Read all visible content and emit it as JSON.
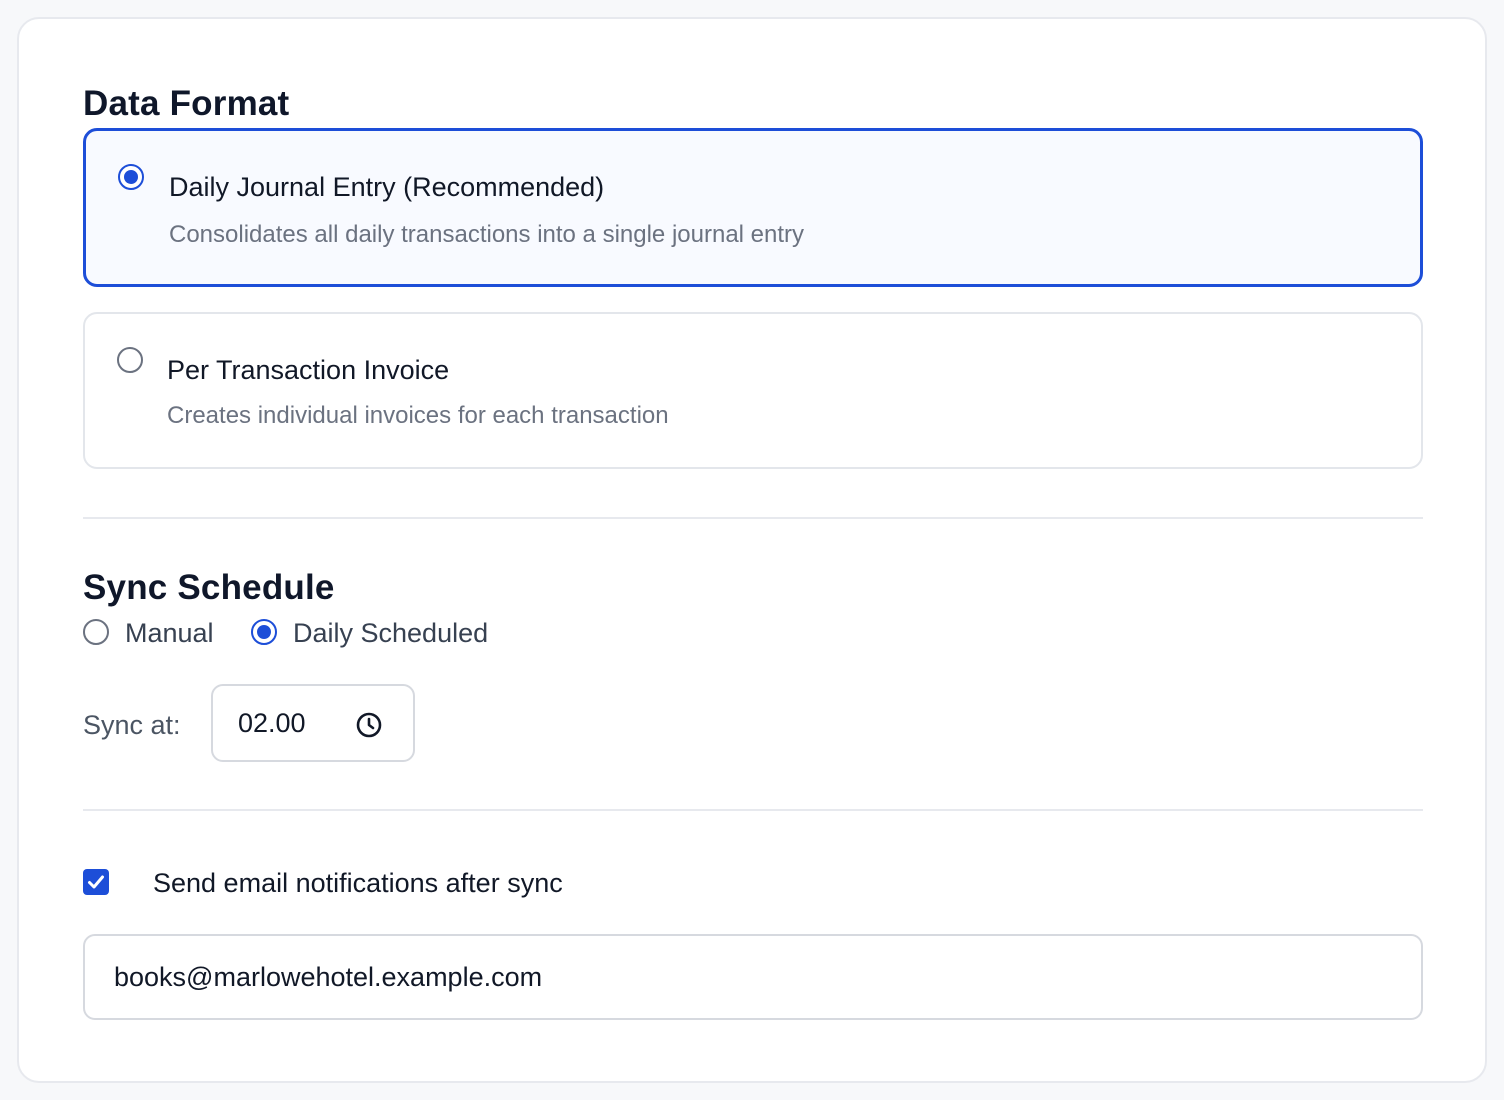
{
  "data_format": {
    "title": "Data Format",
    "options": [
      {
        "title": "Daily Journal Entry (Recommended)",
        "description": "Consolidates all daily transactions into a single journal entry",
        "selected": true
      },
      {
        "title": "Per Transaction Invoice",
        "description": "Creates individual invoices for each transaction",
        "selected": false
      }
    ]
  },
  "sync_schedule": {
    "title": "Sync Schedule",
    "modes": [
      {
        "label": "Manual",
        "selected": false
      },
      {
        "label": "Daily Scheduled",
        "selected": true
      }
    ],
    "sync_at_label": "Sync at:",
    "sync_time": "02.00",
    "time_icon": "clock-icon"
  },
  "notifications": {
    "checkbox_label": "Send email notifications after sync",
    "checked": true,
    "email_value": "books@marlowehotel.example.com"
  },
  "colors": {
    "accent": "#1d4ed8",
    "muted_text": "#6b7280",
    "border": "#e3e6eb"
  }
}
